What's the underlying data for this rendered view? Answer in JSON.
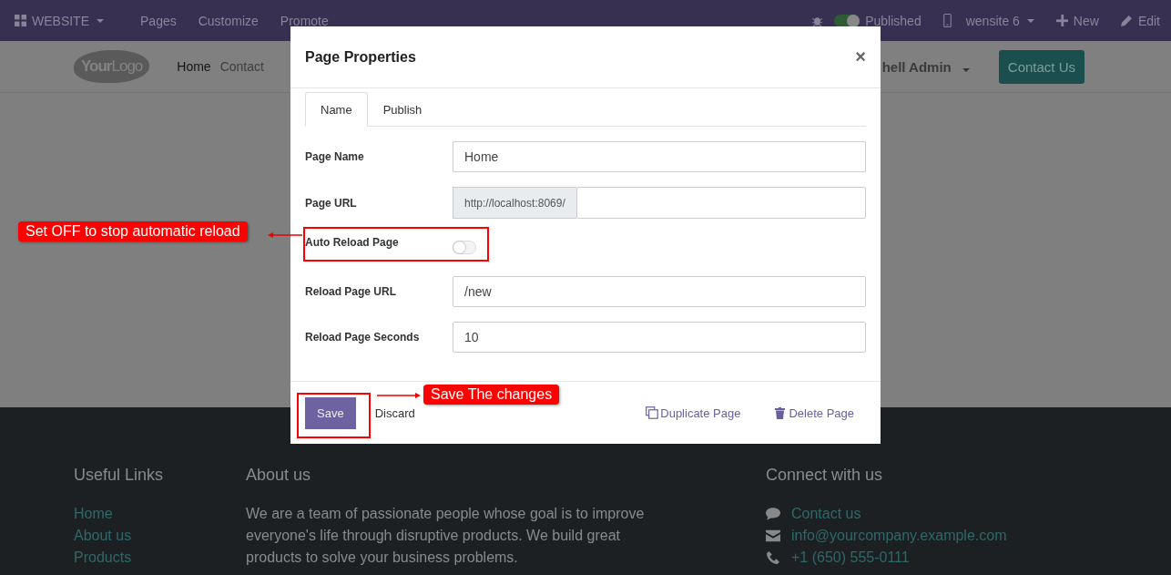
{
  "admin_bar": {
    "app_menu": "WEBSITE",
    "items": [
      "Pages",
      "Customize",
      "Promote"
    ],
    "published": {
      "label": "Published",
      "on": true
    },
    "website": "wensite 6",
    "new": "New",
    "edit": "Edit"
  },
  "header": {
    "logo": "**Your**Logo",
    "nav": [
      {
        "label": "Home",
        "selected": true
      },
      {
        "label": "Contact",
        "selected": false
      }
    ],
    "user": "hell Admin",
    "cta": "Contact Us"
  },
  "modal": {
    "title": "Page Properties",
    "close": "×",
    "tabs": [
      {
        "label": "Name",
        "selected": true
      },
      {
        "label": "Publish",
        "selected": false
      }
    ],
    "fields": [
      {
        "kind": "text",
        "label": "Page Name",
        "value": "Home"
      },
      {
        "kind": "url",
        "label": "Page URL",
        "prefix": "http://localhost:8069/"
      },
      {
        "kind": "toggle",
        "label": "Auto Reload Page",
        "on": false
      },
      {
        "kind": "text",
        "label": "Reload Page URL",
        "value": "/new"
      },
      {
        "kind": "text",
        "label": "Reload Page Seconds",
        "value": "10"
      }
    ],
    "save": "Save",
    "discard": "Discard",
    "duplicate": "Duplicate Page",
    "delete": "Delete Page"
  },
  "annotations": [
    {
      "kind": "toggle",
      "text": "Set OFF to stop automatic reload"
    },
    {
      "kind": "save",
      "text": "Save The changes"
    }
  ],
  "footer": {
    "links_title": "Useful Links",
    "links": [
      "Home",
      "About us",
      "Products"
    ],
    "about_title": "About us",
    "about": "We are a team of passionate people whose goal is to improve everyone's life through disruptive products. We build great products to solve your business problems.",
    "connect_title": "Connect with us",
    "contacts": [
      {
        "kind": "chat",
        "text": "Contact us"
      },
      {
        "kind": "mail",
        "text": "info@yourcompany.example.com"
      },
      {
        "kind": "phone",
        "text": "+1 (650) 555-0111"
      }
    ]
  }
}
